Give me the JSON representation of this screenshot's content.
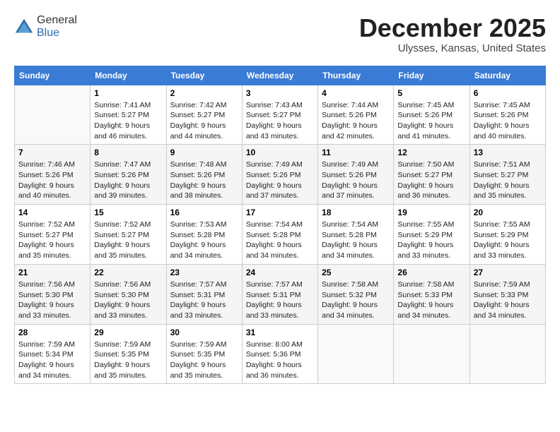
{
  "header": {
    "logo_general": "General",
    "logo_blue": "Blue",
    "month_title": "December 2025",
    "location": "Ulysses, Kansas, United States"
  },
  "weekdays": [
    "Sunday",
    "Monday",
    "Tuesday",
    "Wednesday",
    "Thursday",
    "Friday",
    "Saturday"
  ],
  "weeks": [
    [
      {
        "day": "",
        "detail": ""
      },
      {
        "day": "1",
        "detail": "Sunrise: 7:41 AM\nSunset: 5:27 PM\nDaylight: 9 hours\nand 46 minutes."
      },
      {
        "day": "2",
        "detail": "Sunrise: 7:42 AM\nSunset: 5:27 PM\nDaylight: 9 hours\nand 44 minutes."
      },
      {
        "day": "3",
        "detail": "Sunrise: 7:43 AM\nSunset: 5:27 PM\nDaylight: 9 hours\nand 43 minutes."
      },
      {
        "day": "4",
        "detail": "Sunrise: 7:44 AM\nSunset: 5:26 PM\nDaylight: 9 hours\nand 42 minutes."
      },
      {
        "day": "5",
        "detail": "Sunrise: 7:45 AM\nSunset: 5:26 PM\nDaylight: 9 hours\nand 41 minutes."
      },
      {
        "day": "6",
        "detail": "Sunrise: 7:45 AM\nSunset: 5:26 PM\nDaylight: 9 hours\nand 40 minutes."
      }
    ],
    [
      {
        "day": "7",
        "detail": "Sunrise: 7:46 AM\nSunset: 5:26 PM\nDaylight: 9 hours\nand 40 minutes."
      },
      {
        "day": "8",
        "detail": "Sunrise: 7:47 AM\nSunset: 5:26 PM\nDaylight: 9 hours\nand 39 minutes."
      },
      {
        "day": "9",
        "detail": "Sunrise: 7:48 AM\nSunset: 5:26 PM\nDaylight: 9 hours\nand 38 minutes."
      },
      {
        "day": "10",
        "detail": "Sunrise: 7:49 AM\nSunset: 5:26 PM\nDaylight: 9 hours\nand 37 minutes."
      },
      {
        "day": "11",
        "detail": "Sunrise: 7:49 AM\nSunset: 5:26 PM\nDaylight: 9 hours\nand 37 minutes."
      },
      {
        "day": "12",
        "detail": "Sunrise: 7:50 AM\nSunset: 5:27 PM\nDaylight: 9 hours\nand 36 minutes."
      },
      {
        "day": "13",
        "detail": "Sunrise: 7:51 AM\nSunset: 5:27 PM\nDaylight: 9 hours\nand 35 minutes."
      }
    ],
    [
      {
        "day": "14",
        "detail": "Sunrise: 7:52 AM\nSunset: 5:27 PM\nDaylight: 9 hours\nand 35 minutes."
      },
      {
        "day": "15",
        "detail": "Sunrise: 7:52 AM\nSunset: 5:27 PM\nDaylight: 9 hours\nand 35 minutes."
      },
      {
        "day": "16",
        "detail": "Sunrise: 7:53 AM\nSunset: 5:28 PM\nDaylight: 9 hours\nand 34 minutes."
      },
      {
        "day": "17",
        "detail": "Sunrise: 7:54 AM\nSunset: 5:28 PM\nDaylight: 9 hours\nand 34 minutes."
      },
      {
        "day": "18",
        "detail": "Sunrise: 7:54 AM\nSunset: 5:28 PM\nDaylight: 9 hours\nand 34 minutes."
      },
      {
        "day": "19",
        "detail": "Sunrise: 7:55 AM\nSunset: 5:29 PM\nDaylight: 9 hours\nand 33 minutes."
      },
      {
        "day": "20",
        "detail": "Sunrise: 7:55 AM\nSunset: 5:29 PM\nDaylight: 9 hours\nand 33 minutes."
      }
    ],
    [
      {
        "day": "21",
        "detail": "Sunrise: 7:56 AM\nSunset: 5:30 PM\nDaylight: 9 hours\nand 33 minutes."
      },
      {
        "day": "22",
        "detail": "Sunrise: 7:56 AM\nSunset: 5:30 PM\nDaylight: 9 hours\nand 33 minutes."
      },
      {
        "day": "23",
        "detail": "Sunrise: 7:57 AM\nSunset: 5:31 PM\nDaylight: 9 hours\nand 33 minutes."
      },
      {
        "day": "24",
        "detail": "Sunrise: 7:57 AM\nSunset: 5:31 PM\nDaylight: 9 hours\nand 33 minutes."
      },
      {
        "day": "25",
        "detail": "Sunrise: 7:58 AM\nSunset: 5:32 PM\nDaylight: 9 hours\nand 34 minutes."
      },
      {
        "day": "26",
        "detail": "Sunrise: 7:58 AM\nSunset: 5:33 PM\nDaylight: 9 hours\nand 34 minutes."
      },
      {
        "day": "27",
        "detail": "Sunrise: 7:59 AM\nSunset: 5:33 PM\nDaylight: 9 hours\nand 34 minutes."
      }
    ],
    [
      {
        "day": "28",
        "detail": "Sunrise: 7:59 AM\nSunset: 5:34 PM\nDaylight: 9 hours\nand 34 minutes."
      },
      {
        "day": "29",
        "detail": "Sunrise: 7:59 AM\nSunset: 5:35 PM\nDaylight: 9 hours\nand 35 minutes."
      },
      {
        "day": "30",
        "detail": "Sunrise: 7:59 AM\nSunset: 5:35 PM\nDaylight: 9 hours\nand 35 minutes."
      },
      {
        "day": "31",
        "detail": "Sunrise: 8:00 AM\nSunset: 5:36 PM\nDaylight: 9 hours\nand 36 minutes."
      },
      {
        "day": "",
        "detail": ""
      },
      {
        "day": "",
        "detail": ""
      },
      {
        "day": "",
        "detail": ""
      }
    ]
  ]
}
